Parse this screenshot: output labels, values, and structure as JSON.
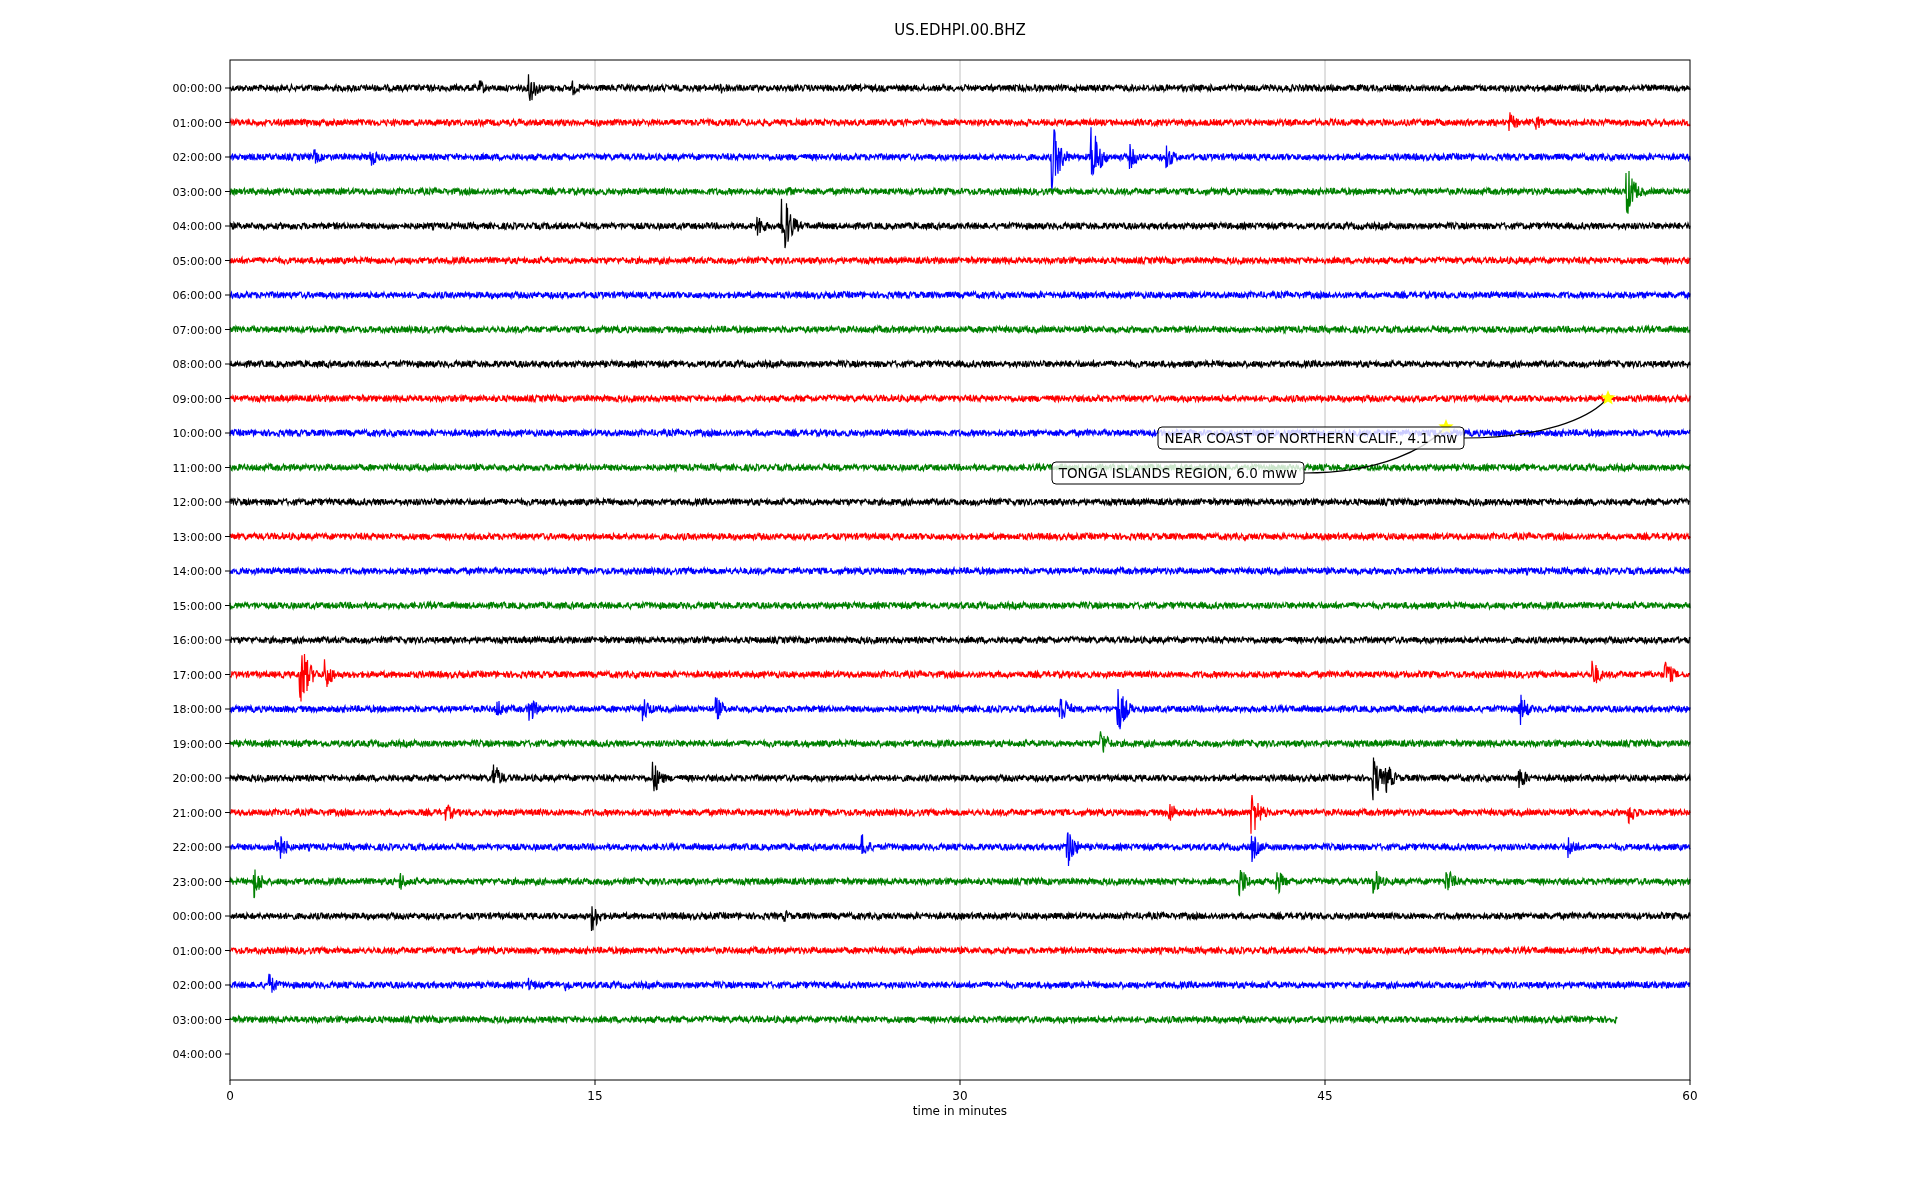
{
  "plot": {
    "title": "US.EDHPI.00.BHZ",
    "xlabel": "time in minutes",
    "xticks": [
      "0",
      "15",
      "30",
      "45",
      "60"
    ],
    "rows": [
      {
        "label": "00:00:00",
        "color": "#000000"
      },
      {
        "label": "01:00:00",
        "color": "#ff0000"
      },
      {
        "label": "02:00:00",
        "color": "#0000ff"
      },
      {
        "label": "03:00:00",
        "color": "#008000"
      },
      {
        "label": "04:00:00",
        "color": "#000000"
      },
      {
        "label": "05:00:00",
        "color": "#ff0000"
      },
      {
        "label": "06:00:00",
        "color": "#0000ff"
      },
      {
        "label": "07:00:00",
        "color": "#008000"
      },
      {
        "label": "08:00:00",
        "color": "#000000"
      },
      {
        "label": "09:00:00",
        "color": "#ff0000"
      },
      {
        "label": "10:00:00",
        "color": "#0000ff"
      },
      {
        "label": "11:00:00",
        "color": "#008000"
      },
      {
        "label": "12:00:00",
        "color": "#000000"
      },
      {
        "label": "13:00:00",
        "color": "#ff0000"
      },
      {
        "label": "14:00:00",
        "color": "#0000ff"
      },
      {
        "label": "15:00:00",
        "color": "#008000"
      },
      {
        "label": "16:00:00",
        "color": "#000000"
      },
      {
        "label": "17:00:00",
        "color": "#ff0000"
      },
      {
        "label": "18:00:00",
        "color": "#0000ff"
      },
      {
        "label": "19:00:00",
        "color": "#008000"
      },
      {
        "label": "20:00:00",
        "color": "#000000"
      },
      {
        "label": "21:00:00",
        "color": "#ff0000"
      },
      {
        "label": "22:00:00",
        "color": "#0000ff"
      },
      {
        "label": "23:00:00",
        "color": "#008000"
      },
      {
        "label": "00:00:00",
        "color": "#000000"
      },
      {
        "label": "01:00:00",
        "color": "#ff0000"
      },
      {
        "label": "02:00:00",
        "color": "#0000ff"
      },
      {
        "label": "03:00:00",
        "color": "#008000"
      },
      {
        "label": "04:00:00"
      }
    ],
    "annotations": [
      {
        "text": "TONGA ISLANDS REGION, 6.0 mww",
        "color": "#ffff00"
      },
      {
        "text": "NEAR COAST OF NORTHERN CALIF., 4.1 mw",
        "color": "#ffff00"
      }
    ]
  }
}
